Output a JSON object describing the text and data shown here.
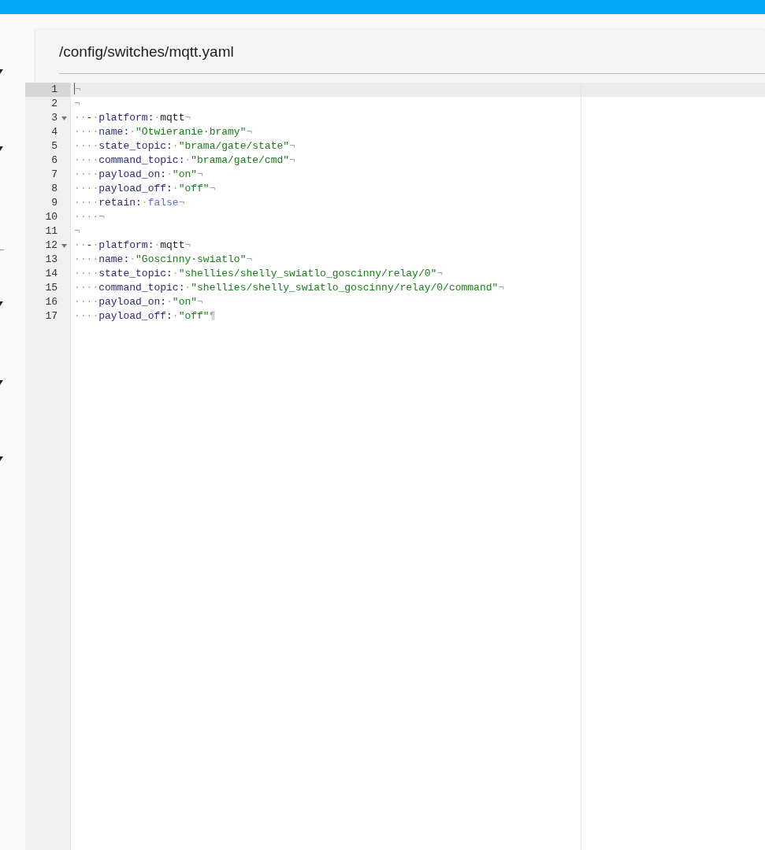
{
  "file_path": "/config/switches/mqtt.yaml",
  "editor": {
    "lines": [
      {
        "number": "1",
        "active": true,
        "fold": false,
        "tokens": [
          {
            "kind": "ws",
            "text": "¬"
          }
        ]
      },
      {
        "number": "2",
        "active": false,
        "fold": false,
        "tokens": [
          {
            "kind": "ws",
            "text": "¬"
          }
        ]
      },
      {
        "number": "3",
        "active": false,
        "fold": true,
        "tokens": [
          {
            "kind": "ws",
            "text": "··"
          },
          {
            "kind": "punct",
            "text": "-"
          },
          {
            "kind": "ws",
            "text": "·"
          },
          {
            "kind": "key",
            "text": "platform:"
          },
          {
            "kind": "ws",
            "text": "·"
          },
          {
            "kind": "plain",
            "text": "mqtt"
          },
          {
            "kind": "ws",
            "text": "¬"
          }
        ]
      },
      {
        "number": "4",
        "active": false,
        "fold": false,
        "tokens": [
          {
            "kind": "ws",
            "text": "····"
          },
          {
            "kind": "key",
            "text": "name:"
          },
          {
            "kind": "ws",
            "text": "·"
          },
          {
            "kind": "string",
            "text": "\"Otwieranie·bramy\""
          },
          {
            "kind": "ws",
            "text": "¬"
          }
        ]
      },
      {
        "number": "5",
        "active": false,
        "fold": false,
        "tokens": [
          {
            "kind": "ws",
            "text": "····"
          },
          {
            "kind": "key",
            "text": "state_topic:"
          },
          {
            "kind": "ws",
            "text": "·"
          },
          {
            "kind": "string",
            "text": "\"brama/gate/state\""
          },
          {
            "kind": "ws",
            "text": "¬"
          }
        ]
      },
      {
        "number": "6",
        "active": false,
        "fold": false,
        "tokens": [
          {
            "kind": "ws",
            "text": "····"
          },
          {
            "kind": "key",
            "text": "command_topic:"
          },
          {
            "kind": "ws",
            "text": "·"
          },
          {
            "kind": "string",
            "text": "\"brama/gate/cmd\""
          },
          {
            "kind": "ws",
            "text": "¬"
          }
        ]
      },
      {
        "number": "7",
        "active": false,
        "fold": false,
        "tokens": [
          {
            "kind": "ws",
            "text": "····"
          },
          {
            "kind": "key",
            "text": "payload_on:"
          },
          {
            "kind": "ws",
            "text": "·"
          },
          {
            "kind": "string",
            "text": "\"on\""
          },
          {
            "kind": "ws",
            "text": "¬"
          }
        ]
      },
      {
        "number": "8",
        "active": false,
        "fold": false,
        "tokens": [
          {
            "kind": "ws",
            "text": "····"
          },
          {
            "kind": "key",
            "text": "payload_off:"
          },
          {
            "kind": "ws",
            "text": "·"
          },
          {
            "kind": "string",
            "text": "\"off\""
          },
          {
            "kind": "ws",
            "text": "¬"
          }
        ]
      },
      {
        "number": "9",
        "active": false,
        "fold": false,
        "tokens": [
          {
            "kind": "ws",
            "text": "····"
          },
          {
            "kind": "key",
            "text": "retain:"
          },
          {
            "kind": "ws",
            "text": "·"
          },
          {
            "kind": "bool",
            "text": "false"
          },
          {
            "kind": "ws",
            "text": "¬"
          }
        ]
      },
      {
        "number": "10",
        "active": false,
        "fold": false,
        "tokens": [
          {
            "kind": "ws",
            "text": "····¬"
          }
        ]
      },
      {
        "number": "11",
        "active": false,
        "fold": false,
        "tokens": [
          {
            "kind": "ws",
            "text": "¬"
          }
        ]
      },
      {
        "number": "12",
        "active": false,
        "fold": true,
        "tokens": [
          {
            "kind": "ws",
            "text": "··"
          },
          {
            "kind": "punct",
            "text": "-"
          },
          {
            "kind": "ws",
            "text": "·"
          },
          {
            "kind": "key",
            "text": "platform:"
          },
          {
            "kind": "ws",
            "text": "·"
          },
          {
            "kind": "plain",
            "text": "mqtt"
          },
          {
            "kind": "ws",
            "text": "¬"
          }
        ]
      },
      {
        "number": "13",
        "active": false,
        "fold": false,
        "tokens": [
          {
            "kind": "ws",
            "text": "····"
          },
          {
            "kind": "key",
            "text": "name:"
          },
          {
            "kind": "ws",
            "text": "·"
          },
          {
            "kind": "string",
            "text": "\"Goscinny·swiatlo\""
          },
          {
            "kind": "ws",
            "text": "¬"
          }
        ]
      },
      {
        "number": "14",
        "active": false,
        "fold": false,
        "tokens": [
          {
            "kind": "ws",
            "text": "····"
          },
          {
            "kind": "key",
            "text": "state_topic:"
          },
          {
            "kind": "ws",
            "text": "·"
          },
          {
            "kind": "string",
            "text": "\"shellies/shelly_swiatlo_goscinny/relay/0\""
          },
          {
            "kind": "ws",
            "text": "¬"
          }
        ]
      },
      {
        "number": "15",
        "active": false,
        "fold": false,
        "tokens": [
          {
            "kind": "ws",
            "text": "····"
          },
          {
            "kind": "key",
            "text": "command_topic:"
          },
          {
            "kind": "ws",
            "text": "·"
          },
          {
            "kind": "string",
            "text": "\"shellies/shelly_swiatlo_goscinny/relay/0/command\""
          },
          {
            "kind": "ws",
            "text": "¬"
          }
        ]
      },
      {
        "number": "16",
        "active": false,
        "fold": false,
        "tokens": [
          {
            "kind": "ws",
            "text": "····"
          },
          {
            "kind": "key",
            "text": "payload_on:"
          },
          {
            "kind": "ws",
            "text": "·"
          },
          {
            "kind": "string",
            "text": "\"on\""
          },
          {
            "kind": "ws",
            "text": "¬"
          }
        ]
      },
      {
        "number": "17",
        "active": false,
        "fold": false,
        "tokens": [
          {
            "kind": "ws",
            "text": "····"
          },
          {
            "kind": "key",
            "text": "payload_off:"
          },
          {
            "kind": "ws",
            "text": "·"
          },
          {
            "kind": "string",
            "text": "\"off\""
          },
          {
            "kind": "ws",
            "text": "¶"
          }
        ]
      }
    ]
  }
}
